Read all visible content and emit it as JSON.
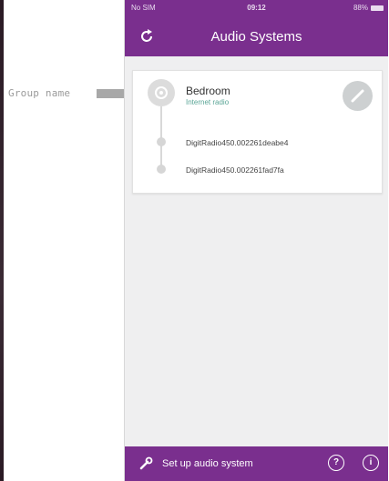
{
  "annotation": {
    "label": "Group name"
  },
  "status_bar": {
    "carrier": "No SIM",
    "time": "09:12",
    "battery": "88%"
  },
  "nav": {
    "title": "Audio Systems",
    "refresh_icon": "refresh-icon"
  },
  "group": {
    "name": "Bedroom",
    "source": "Internet radio",
    "devices": [
      {
        "name": "DigitRadio450.002261deabe4"
      },
      {
        "name": "DigitRadio450.002261fad7fa"
      }
    ]
  },
  "bottom_bar": {
    "setup_label": "Set up audio system",
    "help_glyph": "?",
    "info_glyph": "i"
  },
  "colors": {
    "brand_purple": "#7a2f8e",
    "source_teal": "#5aa596"
  }
}
